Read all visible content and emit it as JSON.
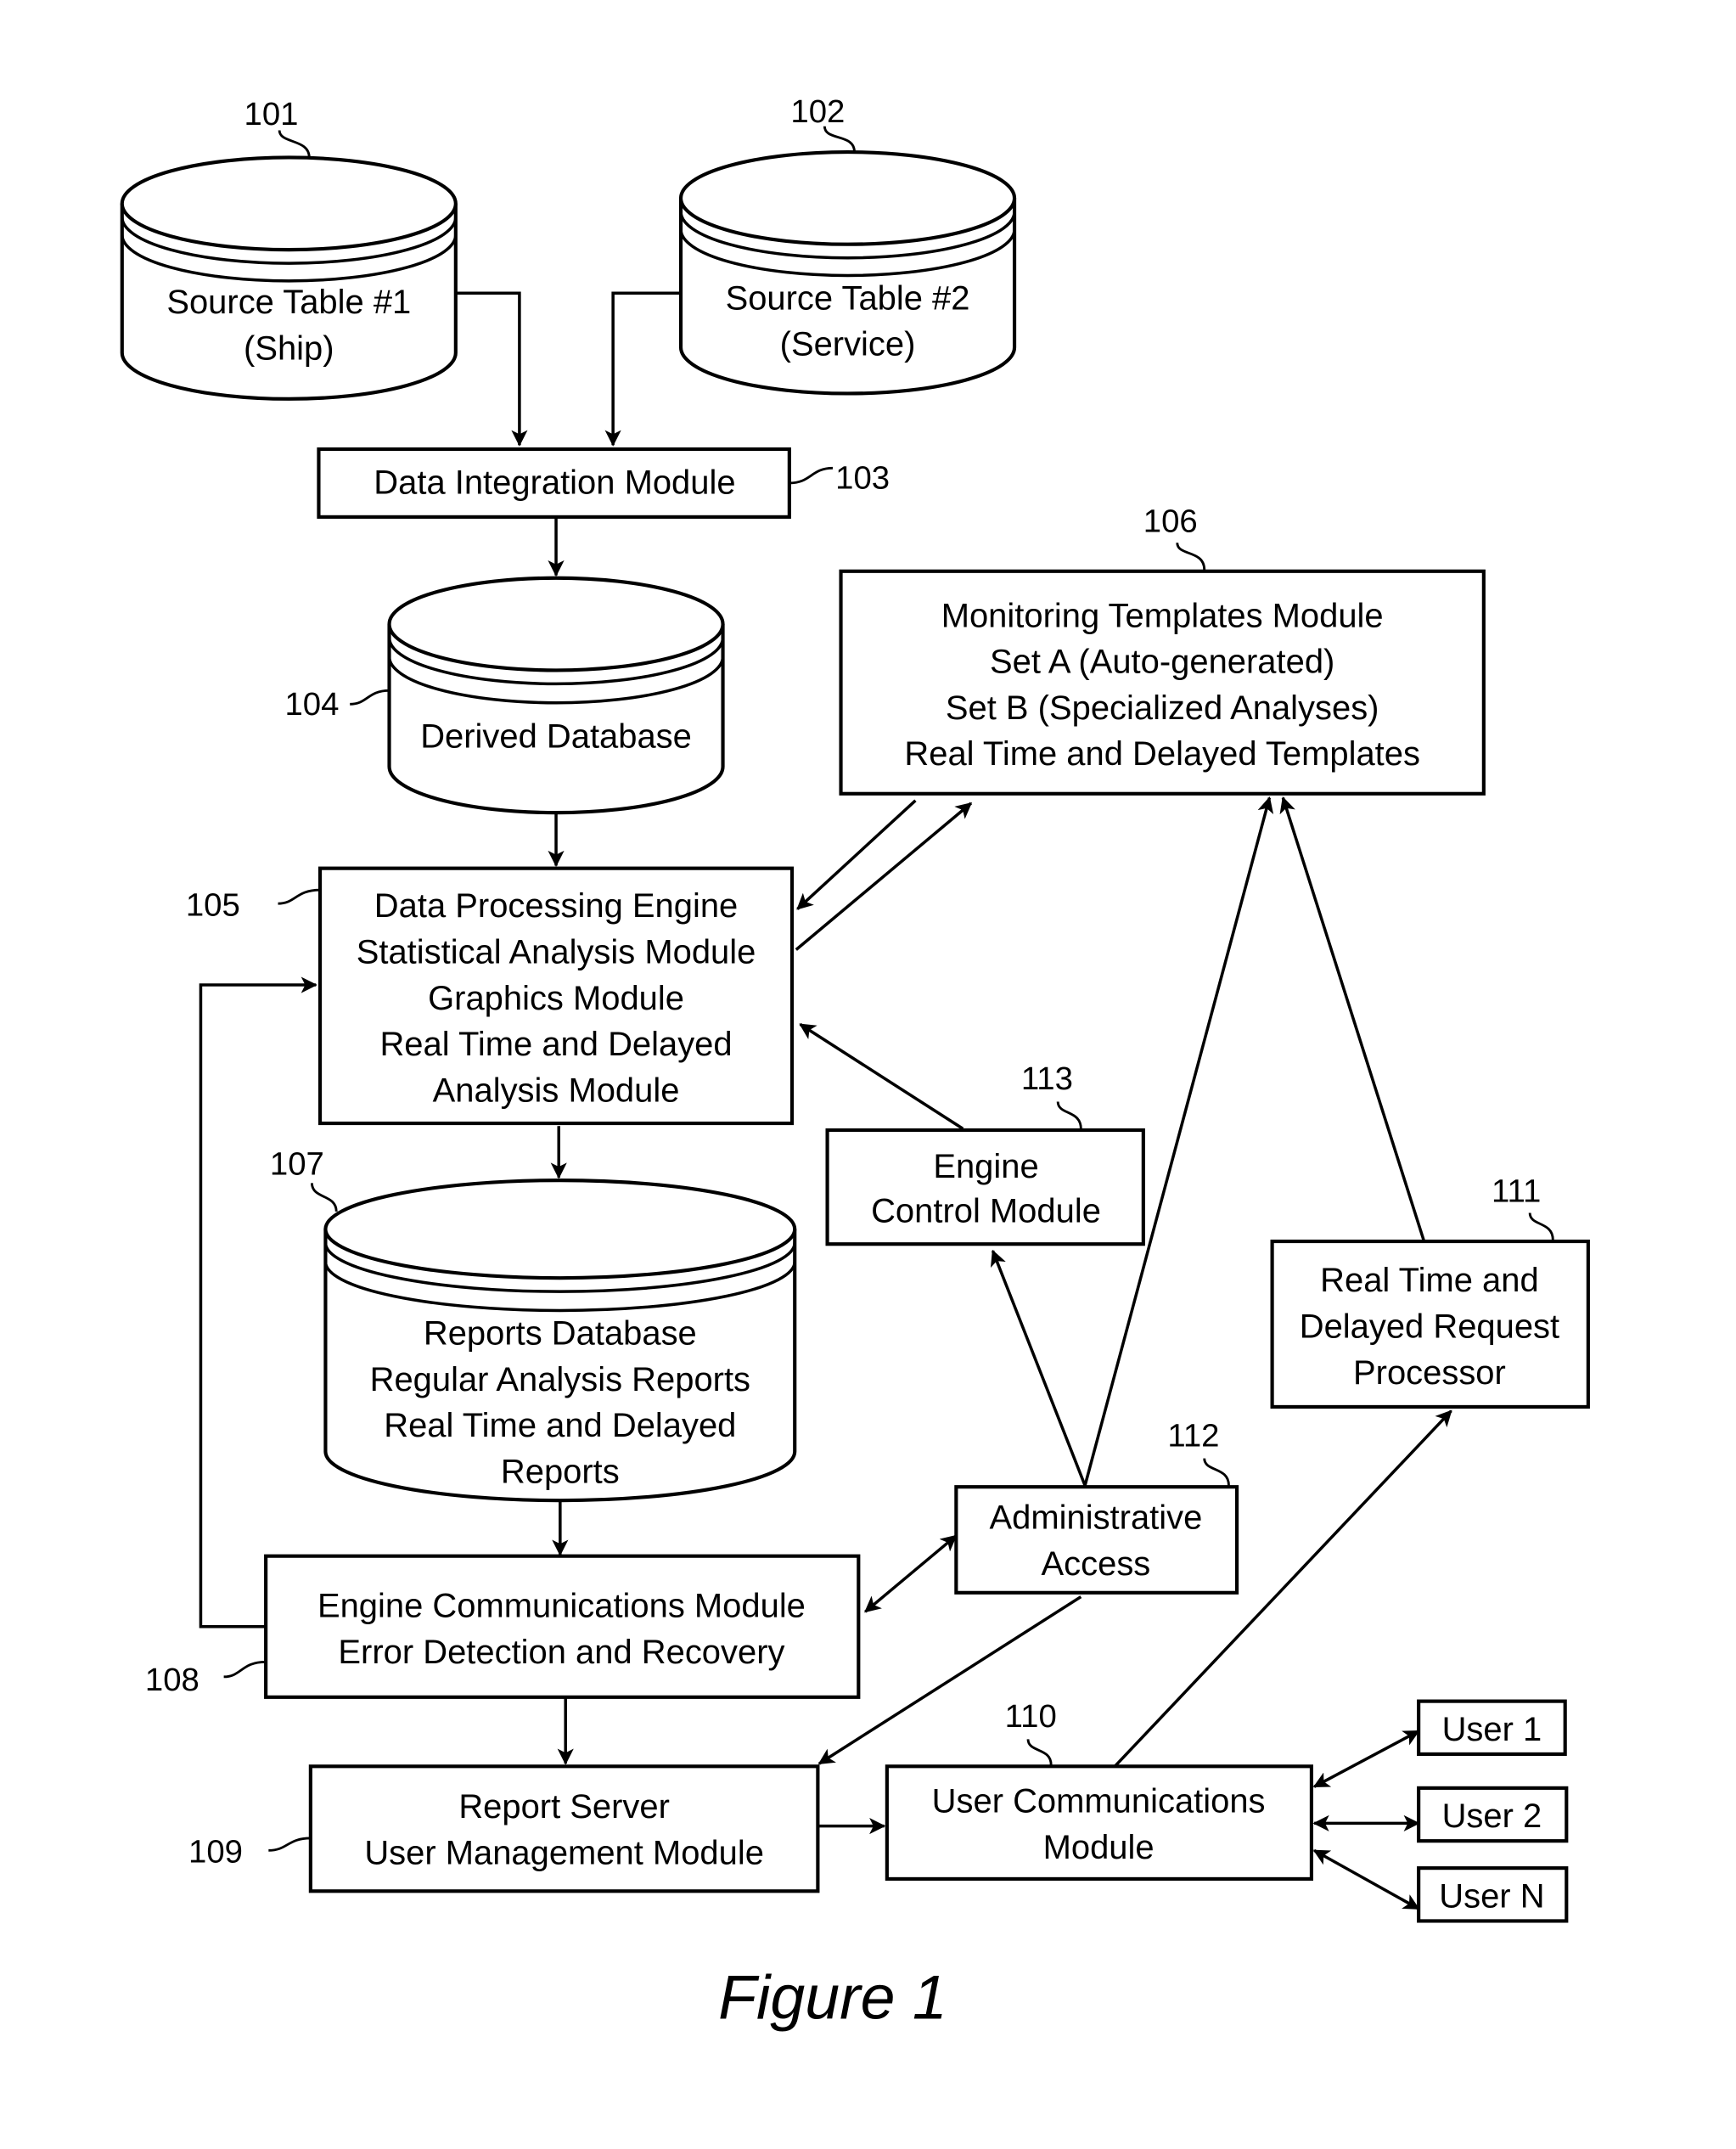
{
  "figure": {
    "caption": "Figure 1",
    "nodes": {
      "src1": {
        "ref": "101",
        "shape": "database",
        "lines": [
          "Source Table #1",
          "(Ship)"
        ]
      },
      "src2": {
        "ref": "102",
        "shape": "database",
        "lines": [
          "Source Table #2",
          "(Service)"
        ]
      },
      "integration": {
        "ref": "103",
        "shape": "box",
        "lines": [
          "Data Integration Module"
        ]
      },
      "derived": {
        "ref": "104",
        "shape": "database",
        "lines": [
          "Derived Database"
        ]
      },
      "engine": {
        "ref": "105",
        "shape": "box",
        "lines": [
          "Data Processing Engine",
          "Statistical Analysis Module",
          "Graphics Module",
          "Real Time and Delayed",
          "Analysis Module"
        ]
      },
      "templates": {
        "ref": "106",
        "shape": "box",
        "lines": [
          "Monitoring Templates Module",
          "Set A (Auto-generated)",
          "Set B (Specialized Analyses)",
          "Real Time and Delayed Templates"
        ]
      },
      "reports": {
        "ref": "107",
        "shape": "database",
        "lines": [
          "Reports Database",
          "Regular Analysis Reports",
          "Real Time and Delayed",
          "Reports"
        ]
      },
      "engine_comm": {
        "ref": "108",
        "shape": "box",
        "lines": [
          "Engine Communications Module",
          "Error Detection and Recovery"
        ]
      },
      "report_server": {
        "ref": "109",
        "shape": "box",
        "lines": [
          "Report Server",
          "User Management Module"
        ]
      },
      "user_comm": {
        "ref": "110",
        "shape": "box",
        "lines": [
          "User Communications",
          "Module"
        ]
      },
      "request_proc": {
        "ref": "111",
        "shape": "box",
        "lines": [
          "Real Time and",
          "Delayed Request",
          "Processor"
        ]
      },
      "admin": {
        "ref": "112",
        "shape": "box",
        "lines": [
          "Administrative",
          "Access"
        ]
      },
      "engine_control": {
        "ref": "113",
        "shape": "box",
        "lines": [
          "Engine",
          "Control Module"
        ]
      },
      "user1": {
        "ref": "",
        "shape": "box",
        "lines": [
          "User 1"
        ]
      },
      "user2": {
        "ref": "",
        "shape": "box",
        "lines": [
          "User 2"
        ]
      },
      "userN": {
        "ref": "",
        "shape": "box",
        "lines": [
          "User N"
        ]
      }
    },
    "edges": [
      {
        "from": "src1",
        "to": "integration",
        "type": "arrow"
      },
      {
        "from": "src2",
        "to": "integration",
        "type": "arrow"
      },
      {
        "from": "integration",
        "to": "derived",
        "type": "arrow"
      },
      {
        "from": "derived",
        "to": "engine",
        "type": "arrow"
      },
      {
        "from": "templates",
        "to": "engine",
        "type": "arrow"
      },
      {
        "from": "engine",
        "to": "templates",
        "type": "arrow"
      },
      {
        "from": "engine_control",
        "to": "engine",
        "type": "arrow"
      },
      {
        "from": "admin",
        "to": "engine_control",
        "type": "arrow"
      },
      {
        "from": "admin",
        "to": "templates",
        "type": "arrow"
      },
      {
        "from": "request_proc",
        "to": "templates",
        "type": "arrow"
      },
      {
        "from": "engine",
        "to": "reports",
        "type": "arrow"
      },
      {
        "from": "reports",
        "to": "engine_comm",
        "type": "arrow"
      },
      {
        "from": "engine_comm",
        "to": "engine",
        "type": "arrow"
      },
      {
        "from": "engine_comm",
        "to": "admin",
        "type": "bidirectional"
      },
      {
        "from": "admin",
        "to": "report_server",
        "type": "arrow"
      },
      {
        "from": "engine_comm",
        "to": "report_server",
        "type": "arrow"
      },
      {
        "from": "report_server",
        "to": "user_comm",
        "type": "arrow"
      },
      {
        "from": "user_comm",
        "to": "request_proc",
        "type": "arrow"
      },
      {
        "from": "user_comm",
        "to": "user1",
        "type": "bidirectional"
      },
      {
        "from": "user_comm",
        "to": "user2",
        "type": "bidirectional"
      },
      {
        "from": "user_comm",
        "to": "userN",
        "type": "bidirectional"
      }
    ]
  }
}
